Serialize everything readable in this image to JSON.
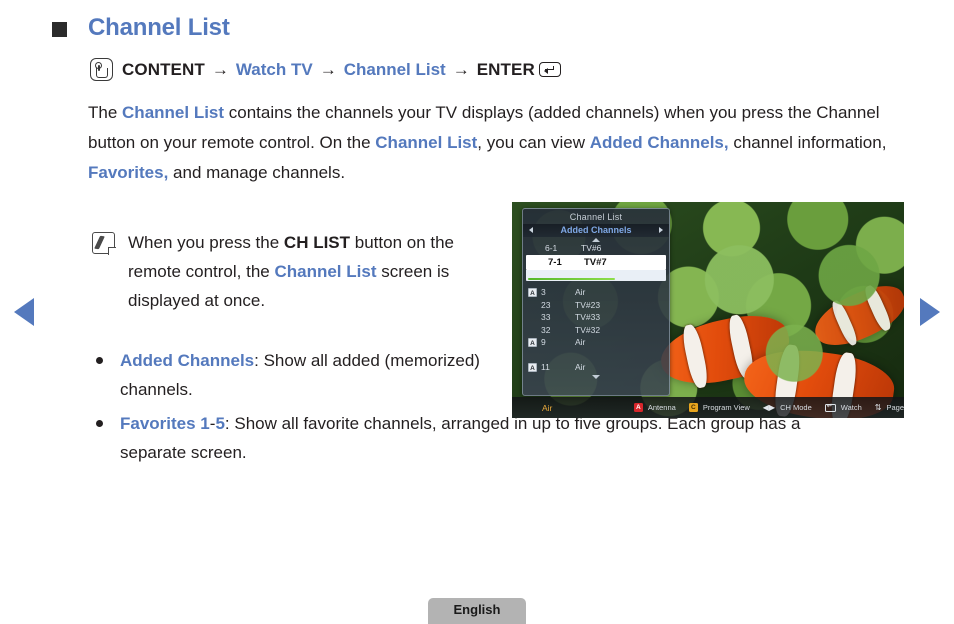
{
  "page": {
    "title": "Channel List",
    "section_marker": "square-bullet"
  },
  "breadcrumb": {
    "icon": "content-button-icon",
    "steps": [
      {
        "text": "CONTENT",
        "style": "bold-dark"
      },
      {
        "text": "Watch TV",
        "style": "bold-blue"
      },
      {
        "text": "Channel List",
        "style": "bold-blue"
      },
      {
        "text": "ENTER",
        "style": "bold-dark"
      }
    ],
    "separator": "→",
    "enter_icon": "enter-key-icon"
  },
  "body": {
    "paragraph": [
      {
        "t": "The ",
        "hl": false
      },
      {
        "t": "Channel List",
        "hl": true
      },
      {
        "t": " contains the channels your TV displays (added channels) when you press the Channel button on your remote control. On the ",
        "hl": false
      },
      {
        "t": "Channel List",
        "hl": true
      },
      {
        "t": ", you can view ",
        "hl": false
      },
      {
        "t": "Added Channels,",
        "hl": true
      },
      {
        "t": " channel information, ",
        "hl": false
      },
      {
        "t": "Favorites,",
        "hl": true
      },
      {
        "t": " and manage channels.",
        "hl": false
      }
    ]
  },
  "note": {
    "icon": "note-pencil-icon",
    "parts": [
      {
        "t": "When you press the ",
        "style": "normal"
      },
      {
        "t": "CH LIST",
        "style": "bold"
      },
      {
        "t": " button on the remote control, the ",
        "style": "normal"
      },
      {
        "t": "Channel List",
        "style": "blue"
      },
      {
        "t": " screen is displayed at once.",
        "style": "normal"
      }
    ]
  },
  "bullets": [
    {
      "parts": [
        {
          "t": "Added Channels",
          "style": "blue"
        },
        {
          "t": ": Show all added (memorized) channels.",
          "style": "normal"
        }
      ]
    },
    {
      "parts": [
        {
          "t": "Favorites 1",
          "style": "blue"
        },
        {
          "t": "-",
          "style": "normal"
        },
        {
          "t": "5",
          "style": "blue"
        },
        {
          "t": ": Show all favorite channels, arranged in up to five groups. Each group has a separate screen.",
          "style": "normal"
        }
      ]
    }
  ],
  "tv_screenshot": {
    "panel": {
      "title": "Channel List",
      "subtitle": "Added Channels",
      "left_arrow": "prev-arrow-icon",
      "right_arrow": "next-arrow-icon",
      "scroll_up": "scroll-up-caret-icon",
      "scroll_down": "scroll-down-caret-icon",
      "top_row": {
        "number": "6-1",
        "name": "TV#6"
      },
      "selected_row": {
        "number": "7-1",
        "name": "TV#7"
      },
      "progress_percent": 62,
      "rows": [
        {
          "badge": "A",
          "number": "3",
          "name": "Air"
        },
        {
          "badge": "",
          "number": "23",
          "name": "TV#23"
        },
        {
          "badge": "",
          "number": "33",
          "name": "TV#33"
        },
        {
          "badge": "",
          "number": "32",
          "name": "TV#32"
        },
        {
          "badge": "A",
          "number": "9",
          "name": "Air"
        },
        {
          "badge": "",
          "number": "",
          "name": ""
        },
        {
          "badge": "A",
          "number": "11",
          "name": "Air"
        }
      ]
    },
    "status_bar": {
      "air_label": "Air",
      "keys": [
        {
          "badge": "A",
          "badge_color": "#d7262b",
          "label": "Antenna"
        },
        {
          "badge": "C",
          "badge_color": "#e8a51e",
          "label": "Program View"
        },
        {
          "glyph": "◀▶",
          "label": "CH Mode"
        },
        {
          "glyph": "enter-key-icon",
          "label": "Watch"
        },
        {
          "glyph": "⇅",
          "label": "Page"
        }
      ]
    }
  },
  "nav": {
    "prev": "prev-page-arrow",
    "next": "next-page-arrow"
  },
  "footer": {
    "language": "English"
  },
  "colors": {
    "accent_blue": "#5479bd",
    "text_dark": "#231f20",
    "tv_blue": "#7fa8e6",
    "progress_green": "#56b82a",
    "badge_red": "#d7262b",
    "badge_yellow": "#e8a51e",
    "air_gold": "#e8a93c",
    "footer_grey": "#b3b3b3"
  }
}
